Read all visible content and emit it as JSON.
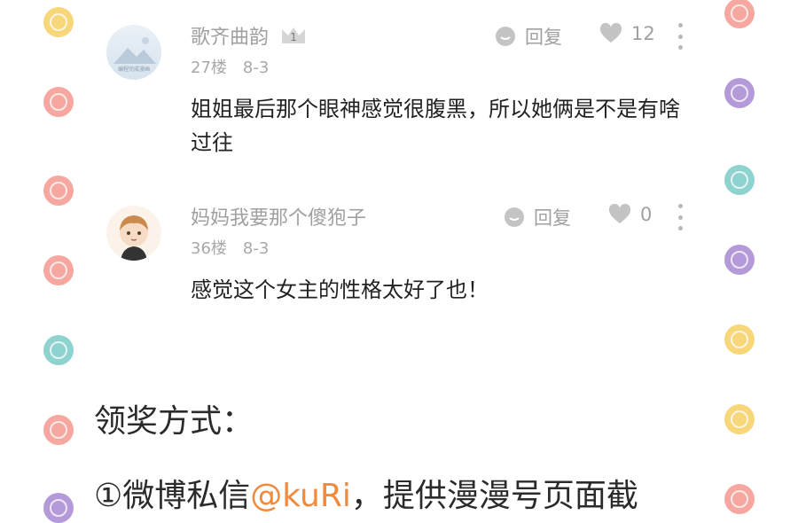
{
  "comments": [
    {
      "username": "歌齐曲韵",
      "floor": "27楼",
      "date": "8-3",
      "reply_label": "回复",
      "likes": "12",
      "avatar_caption": "编程完成漫画",
      "text": "姐姐最后那个眼神感觉很腹黑，所以她俩是不是有啥过往",
      "badge_text": "1"
    },
    {
      "username": "妈妈我要那个傻狍子",
      "floor": "36楼",
      "date": "8-3",
      "reply_label": "回复",
      "likes": "0",
      "text": "感觉这个女主的性格太好了也！"
    }
  ],
  "section": {
    "heading": "领奖方式：",
    "line1_prefix": "①微博私信",
    "line1_mention": "@kuRi",
    "line1_suffix": "，提供漫漫号页面截"
  },
  "colors": {
    "deco_yellow": "#f7d77a",
    "deco_pink": "#f6a8a0",
    "deco_teal": "#8fd3d0",
    "deco_purple": "#b59ad9",
    "mention": "#f08a3c"
  }
}
